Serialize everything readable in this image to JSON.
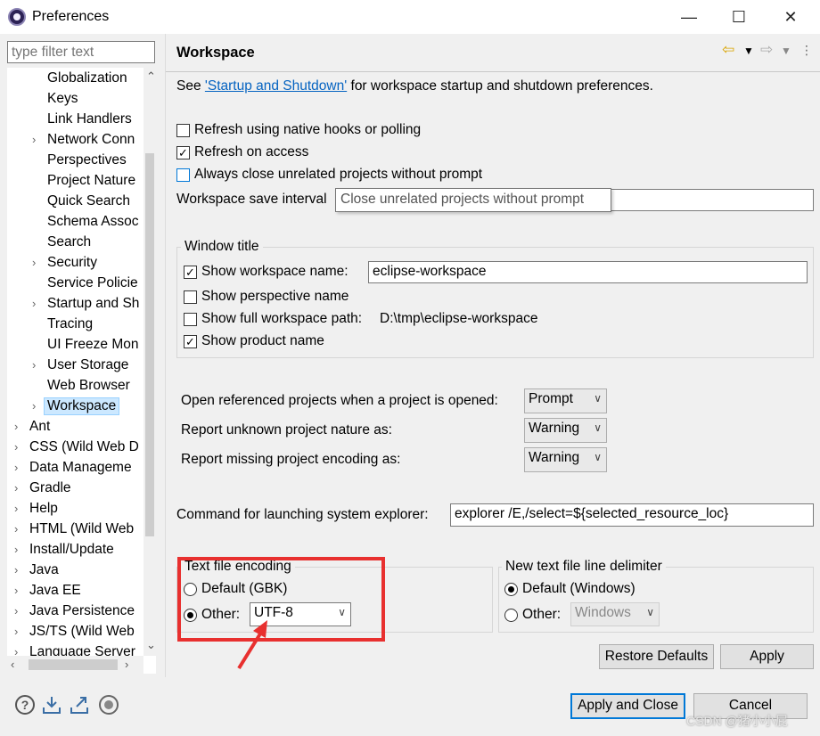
{
  "window": {
    "title": "Preferences",
    "minimize": "—",
    "maximize": "☐",
    "close": "✕"
  },
  "filter": {
    "placeholder": "type filter text"
  },
  "tree": {
    "items": [
      {
        "label": "Globalization",
        "expandable": false
      },
      {
        "label": "Keys",
        "expandable": false
      },
      {
        "label": "Link Handlers",
        "expandable": false
      },
      {
        "label": "Network Conn",
        "expandable": true
      },
      {
        "label": "Perspectives",
        "expandable": false
      },
      {
        "label": "Project Nature",
        "expandable": false
      },
      {
        "label": "Quick Search",
        "expandable": false
      },
      {
        "label": "Schema Assoc",
        "expandable": false
      },
      {
        "label": "Search",
        "expandable": false
      },
      {
        "label": "Security",
        "expandable": true
      },
      {
        "label": "Service Policie",
        "expandable": false
      },
      {
        "label": "Startup and Sh",
        "expandable": true
      },
      {
        "label": "Tracing",
        "expandable": false
      },
      {
        "label": "UI Freeze Mon",
        "expandable": false
      },
      {
        "label": "User Storage",
        "expandable": true
      },
      {
        "label": "Web Browser",
        "expandable": false
      },
      {
        "label": "Workspace",
        "expandable": true,
        "selected": true
      }
    ],
    "top_items": [
      {
        "label": "Ant"
      },
      {
        "label": "CSS (Wild Web D"
      },
      {
        "label": "Data Manageme"
      },
      {
        "label": "Gradle"
      },
      {
        "label": "Help"
      },
      {
        "label": "HTML (Wild Web"
      },
      {
        "label": "Install/Update"
      },
      {
        "label": "Java"
      },
      {
        "label": "Java EE"
      },
      {
        "label": "Java Persistence"
      },
      {
        "label": "JS/TS (Wild Web"
      },
      {
        "label": "Language Server"
      }
    ]
  },
  "pane": {
    "title": "Workspace",
    "see_prefix": "See ",
    "see_link": "'Startup and Shutdown'",
    "see_suffix": " for workspace startup and preferences.",
    "see_suffix_full": " for workspace startup and shutdown preferences.",
    "refresh_native": {
      "label": "Refresh using native hooks or polling",
      "checked": false
    },
    "refresh_access": {
      "label": "Refresh on access",
      "checked": true
    },
    "always_close": {
      "label": "Always close unrelated projects without prompt",
      "checked": false
    },
    "save_interval_label": "Workspace save interval",
    "tooltip": "Close unrelated projects without prompt",
    "window_title": {
      "legend": "Window title",
      "show_workspace_name": {
        "label": "Show workspace name:",
        "checked": true,
        "value": "eclipse-workspace"
      },
      "show_perspective": {
        "label": "Show perspective name",
        "checked": false
      },
      "show_full_path": {
        "label": "Show full workspace path:",
        "checked": false,
        "value": "D:\\tmp\\eclipse-workspace"
      },
      "show_product": {
        "label": "Show product name",
        "checked": true
      }
    },
    "open_referenced": {
      "label": "Open referenced projects when a project is opened:",
      "value": "Prompt"
    },
    "unknown_nature": {
      "label": "Report unknown project nature as:",
      "value": "Warning"
    },
    "missing_encoding": {
      "label": "Report missing project encoding as:",
      "value": "Warning"
    },
    "explorer": {
      "label": "Command for launching system explorer:",
      "value": "explorer /E,/select=${selected_resource_loc}"
    },
    "encoding": {
      "legend": "Text file encoding",
      "default": {
        "label": "Default (GBK)",
        "selected": false
      },
      "other": {
        "label": "Other:",
        "selected": true,
        "value": "UTF-8"
      }
    },
    "delimiter": {
      "legend": "New text file line delimiter",
      "default": {
        "label": "Default (Windows)",
        "selected": true
      },
      "other": {
        "label": "Other:",
        "selected": false,
        "value": "Windows"
      }
    },
    "restore_defaults": "Restore Defaults",
    "apply": "Apply"
  },
  "footer": {
    "apply_close": "Apply and Close",
    "cancel": "Cancel",
    "watermark": "CSDN @猪小小屁"
  },
  "colors": {
    "highlight": "#e8302f",
    "selection": "#cce8ff",
    "link": "#0563c1"
  }
}
